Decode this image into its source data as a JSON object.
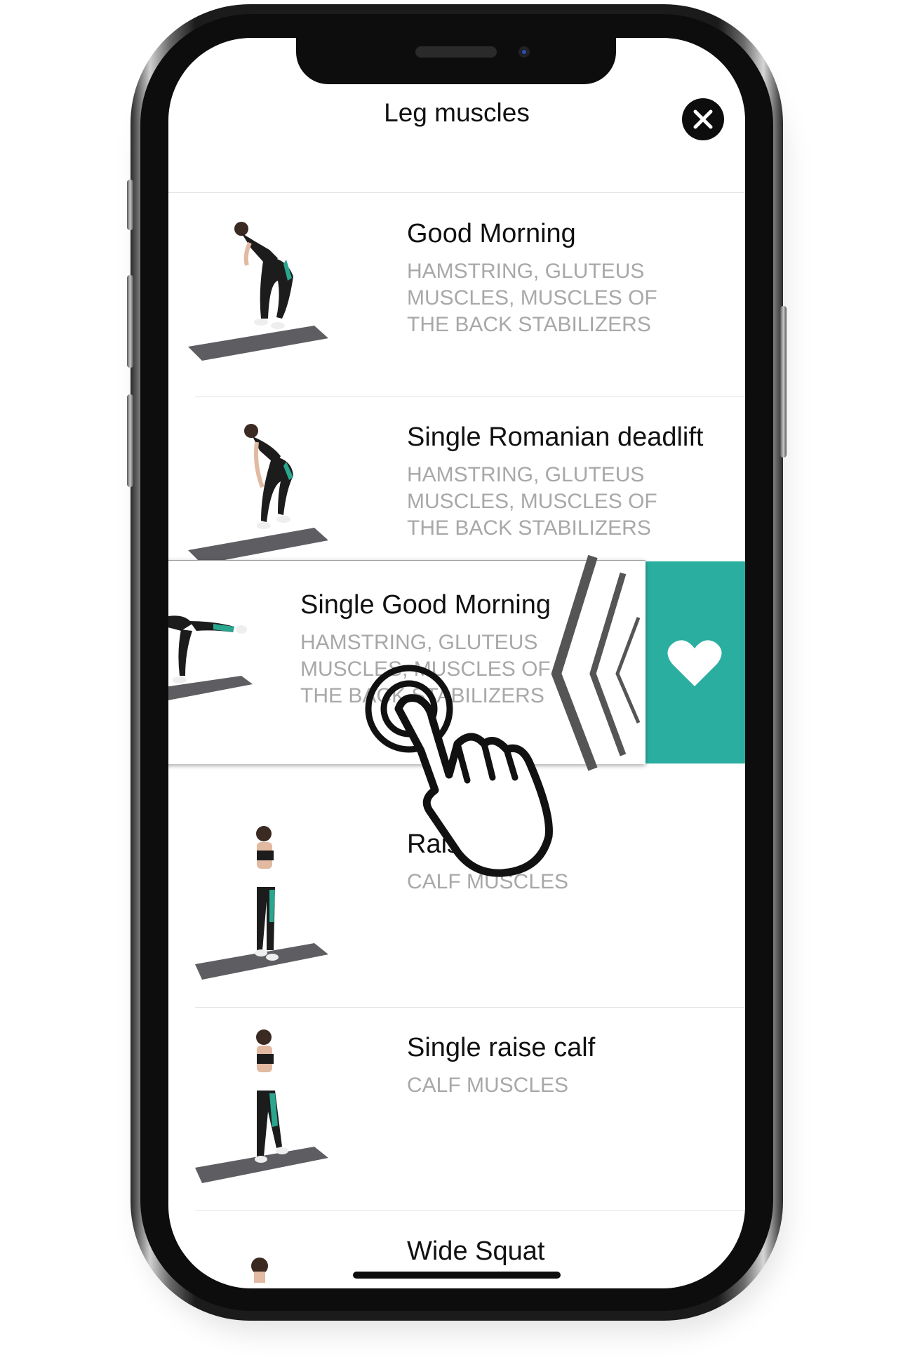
{
  "header": {
    "title": "Leg muscles",
    "close_icon": "close-icon"
  },
  "exercises": [
    {
      "name": "Good Morning",
      "muscles": "HAMSTRING, GLUTEUS MUSCLES, MUSCLES OF THE BACK STABILIZERS"
    },
    {
      "name": "Single Romanian deadlift",
      "muscles": "HAMSTRING, GLUTEUS MUSCLES, MUSCLES OF THE BACK STABILIZERS"
    },
    {
      "name": "Single Good Morning",
      "muscles": "HAMSTRING, GLUTEUS MUSCLES, MUSCLES OF THE BACK STABILIZERS",
      "swipe_action_icon": "heart-icon"
    },
    {
      "name": "Raise calfs",
      "muscles": "CALF MUSCLES"
    },
    {
      "name": "Single raise calf",
      "muscles": "CALF MUSCLES"
    },
    {
      "name": "Wide Squat",
      "muscles": ""
    }
  ],
  "colors": {
    "accent": "#2aaea0",
    "muscle_text": "#a8a8a8",
    "legging_stripe": "#2aa58e"
  },
  "overlay": {
    "gesture_icon": "swipe-left-hand-icon",
    "direction_icon": "chevron-left-icon"
  }
}
